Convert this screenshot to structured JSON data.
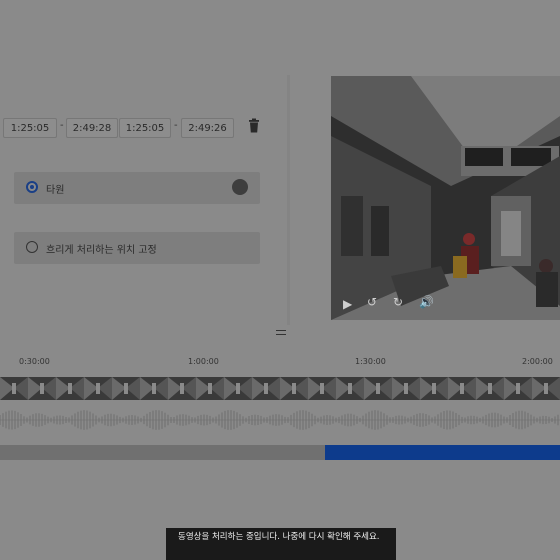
{
  "time_range": {
    "start_1": "1:25:05",
    "end_1": "2:49:28",
    "start_2": "1:25:05",
    "end_2": "2:49:26",
    "separator": "-"
  },
  "blur_options": [
    {
      "label": "타원",
      "selected": true
    },
    {
      "label": "흐리게 처리하는 위치 고정",
      "selected": false
    }
  ],
  "timeline": {
    "ticks": [
      "0:30:00",
      "1:00:00",
      "1:30:00",
      "2:00:00"
    ],
    "progress_percent": 42
  },
  "toast": {
    "message": "동영상을 처리하는 중입니다. 나중에 다시 확인해 주세요."
  },
  "icons": {
    "delete": "trash-icon",
    "play": "play-icon",
    "rewind": "rewind-icon",
    "forward": "forward-icon",
    "volume": "volume-icon"
  },
  "colors": {
    "overlay_bg": "#8a8a8a",
    "accent": "#1a3f86",
    "progress": "#0d3b8c",
    "toast_bg": "#1a1a1a"
  }
}
